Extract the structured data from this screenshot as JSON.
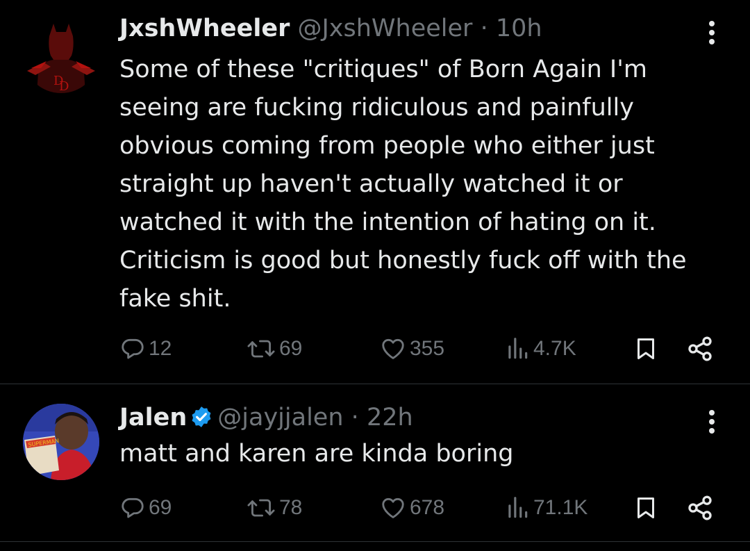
{
  "tweets": [
    {
      "display_name": "JxshWheeler",
      "handle": "@JxshWheeler",
      "separator": "·",
      "time": "10h",
      "verified": false,
      "text": "Some of these \"critiques\" of Born Again I'm seeing are fucking ridiculous and painfully obvious coming from people who either just straight up haven't actually watched it or watched it with the intention of hating on it. Criticism is good but honestly fuck off with the fake shit.",
      "replies": "12",
      "retweets": "69",
      "likes": "355",
      "views": "4.7K"
    },
    {
      "display_name": "Jalen",
      "handle": "@jayjjalen",
      "separator": "·",
      "time": "22h",
      "verified": true,
      "text": "matt and karen are kinda boring",
      "replies": "69",
      "retweets": "78",
      "likes": "678",
      "views": "71.1K"
    }
  ],
  "colors": {
    "background": "#000000",
    "text": "#e7e9ea",
    "secondary": "#71767b",
    "divider": "#2f3336",
    "verified": "#1d9bf0",
    "daredevil_red": "#b3120f"
  },
  "icons": {
    "reply": "reply-icon",
    "retweet": "retweet-icon",
    "like": "heart-icon",
    "views": "views-icon",
    "bookmark": "bookmark-icon",
    "share": "share-icon",
    "more": "more-vertical-icon",
    "verified": "verified-badge-icon"
  }
}
